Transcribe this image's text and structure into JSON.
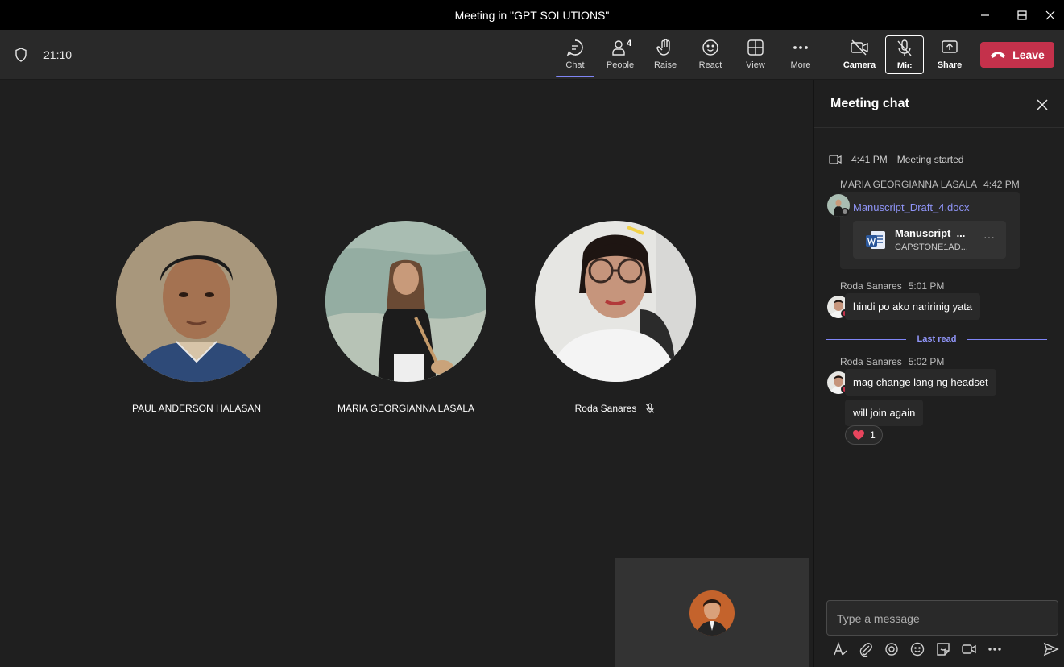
{
  "window": {
    "title": "Meeting in \"GPT SOLUTIONS\""
  },
  "toolbar": {
    "time": "21:10",
    "buttons": [
      {
        "label": "Chat"
      },
      {
        "label": "People",
        "count": "4"
      },
      {
        "label": "Raise"
      },
      {
        "label": "React"
      },
      {
        "label": "View"
      },
      {
        "label": "More"
      },
      {
        "label": "Camera"
      },
      {
        "label": "Mic"
      },
      {
        "label": "Share"
      }
    ],
    "leave_label": "Leave",
    "leave_color": "#c4314b",
    "accent_color": "#7f85f5"
  },
  "participants": [
    {
      "name": "PAUL ANDERSON HALASAN",
      "muted": false
    },
    {
      "name": "MARIA GEORGIANNA LASALA",
      "muted": false
    },
    {
      "name": "Roda Sanares",
      "muted": true
    }
  ],
  "chat": {
    "title": "Meeting chat",
    "system": {
      "time": "4:41 PM",
      "text": "Meeting started"
    },
    "messages": [
      {
        "sender": "MARIA GEORGIANNA LASALA",
        "time": "4:42 PM",
        "file_link": "Manuscript_Draft_4.docx",
        "file_name": "Manuscript_...",
        "file_sub": "CAPSTONE1AD..."
      },
      {
        "sender": "Roda Sanares",
        "time": "5:01 PM",
        "text": "hindi po ako naririnig yata"
      },
      {
        "sender": "Roda Sanares",
        "time": "5:02 PM",
        "text": "mag change lang ng headset"
      },
      {
        "text": "will join again",
        "reaction_count": "1"
      }
    ],
    "last_read": "Last read",
    "compose_placeholder": "Type a message"
  }
}
